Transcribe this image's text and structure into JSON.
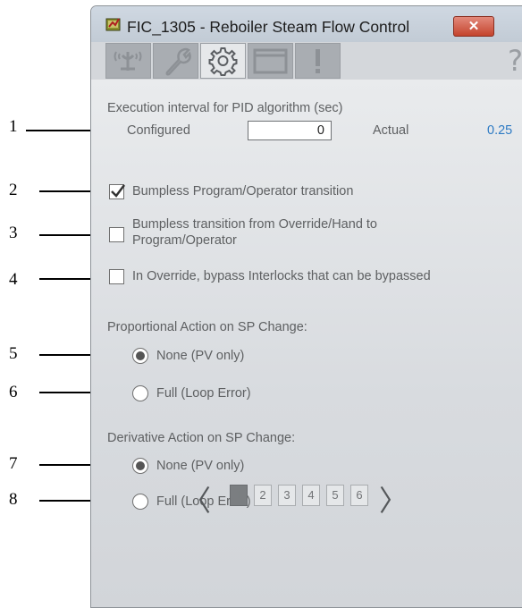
{
  "window": {
    "title": "FIC_1305 - Reboiler Steam Flow Control",
    "close_label": "✕"
  },
  "toolbar": {
    "help_label": "?"
  },
  "execution": {
    "heading": "Execution interval for PID algorithm (sec)",
    "configured_label": "Configured",
    "configured_value": "0",
    "actual_label": "Actual",
    "actual_value": "0.25"
  },
  "options": {
    "bumpless_program_operator": {
      "label": "Bumpless Program/Operator transition",
      "checked": true
    },
    "bumpless_override_hand": {
      "label_line1": "Bumpless transition from Override/Hand to",
      "label_line2": "Program/Operator",
      "checked": false
    },
    "override_bypass_interlocks": {
      "label": "In Override, bypass Interlocks that can be bypassed",
      "checked": false
    }
  },
  "proportional": {
    "heading": "Proportional Action on SP Change:",
    "none_label": "None (PV only)",
    "full_label": "Full (Loop Error)",
    "selected": "none"
  },
  "derivative": {
    "heading": "Derivative Action on SP Change:",
    "none_label": "None (PV only)",
    "full_label": "Full (Loop Error)",
    "selected": "none"
  },
  "pager": {
    "pages": [
      "1",
      "2",
      "3",
      "4",
      "5",
      "6"
    ],
    "current": "1",
    "prev": "〈",
    "next": "〉"
  },
  "callouts": [
    "1",
    "2",
    "3",
    "4",
    "5",
    "6",
    "7",
    "8"
  ],
  "colors": {
    "accent_value": "#2e7bc4",
    "close_button": "#c4442d"
  }
}
